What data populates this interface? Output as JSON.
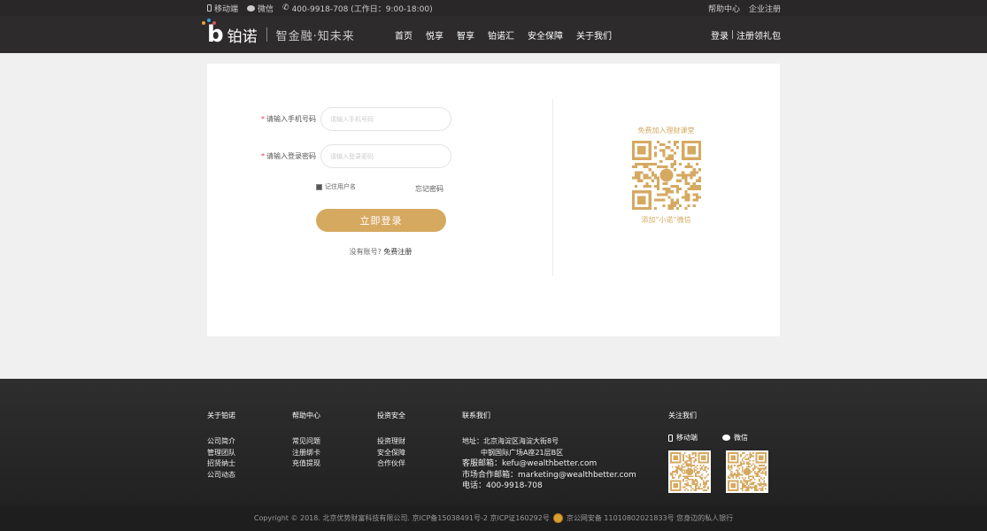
{
  "topbar": {
    "mobile": "移动端",
    "wechat": "微信",
    "phone": "400-9918-708 (工作日：9:00-18:00)",
    "help": "帮助中心",
    "enterprise": "企业注册"
  },
  "header": {
    "logo_text": "铂诺",
    "slogan": "智金融·知未来",
    "nav": [
      "首页",
      "悦享",
      "智享",
      "铂诺汇",
      "安全保障",
      "关于我们"
    ],
    "login": "登录",
    "register": "注册领礼包"
  },
  "login": {
    "phone_label": "请输入手机号码",
    "phone_placeholder": "请输入手机号码",
    "password_label": "请输入登录密码",
    "password_placeholder": "请输入登录密码",
    "remember": "记住用户名",
    "forgot": "忘记密码",
    "submit": "立即登录",
    "no_account": "没有账号?",
    "free_register": "免费注册"
  },
  "qr": {
    "title": "免费加入理财课堂",
    "caption": "添加“小诺”微信"
  },
  "footer": {
    "about": {
      "title": "关于铂诺",
      "items": [
        "公司简介",
        "管理团队",
        "招贤纳士",
        "公司动态"
      ]
    },
    "help": {
      "title": "帮助中心",
      "items": [
        "常见问题",
        "注册绑卡",
        "充值提现"
      ]
    },
    "security": {
      "title": "投资安全",
      "items": [
        "投资理财",
        "安全保障",
        "合作伙伴"
      ]
    },
    "contact": {
      "title": "联系我们",
      "address_label": "地址：",
      "address_line1": "北京海淀区海淀大街8号",
      "address_line2": "中钢国际广场A座21层B区",
      "service_email": "客服邮箱：kefu@wealthbetter.com",
      "market_email": "市场合作邮箱：marketing@wealthbetter.com",
      "tel": "电话：400-9918-708"
    },
    "follow": {
      "title": "关注我们",
      "mobile": "移动端",
      "wechat": "微信"
    },
    "copyright": "Copyright © 2018. 北京优势财富科技有限公司. 京ICP备15038491号-2 京ICP证160292号",
    "police": "京公网安备 11010802021833号 您身边的私人银行"
  },
  "colors": {
    "gold": "#d6a961",
    "dark": "#2d2b2c"
  }
}
